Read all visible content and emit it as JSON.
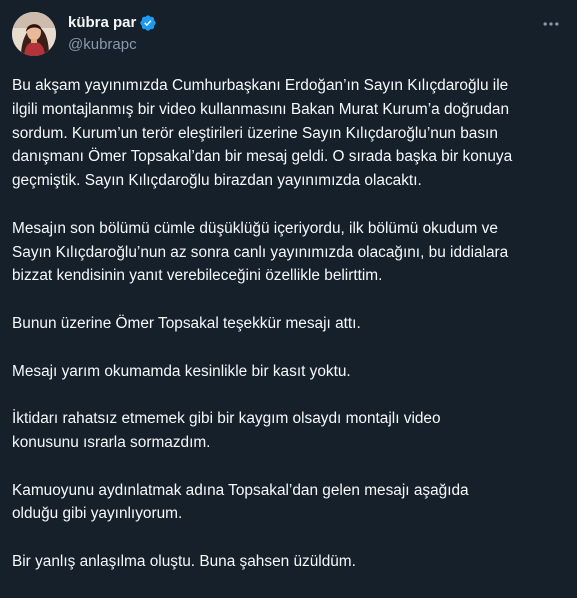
{
  "author": {
    "display_name": "kübra par",
    "handle": "@kubrapc",
    "verified": true,
    "avatar_icon": "user-avatar-photo",
    "verified_icon": "verified-badge-icon",
    "verified_color": "#1d9bf0"
  },
  "actions": {
    "more_icon": "more-horizontal-icon"
  },
  "tweet": {
    "paragraphs": [
      {
        "lines": [
          "Bu akşam yayınımızda Cumhurbaşkanı Erdoğan’ın Sayın Kılıçdaroğlu ile",
          "ilgili montajlanmış bir video kullanmasını Bakan Murat Kurum’a doğrudan",
          "sordum. Kurum’un terör eleştirileri üzerine Sayın Kılıçdaroğlu’nun basın",
          "danışmanı Ömer Topsakal’dan bir mesaj geldi. O sırada başka bir konuya",
          "geçmiştik. Sayın Kılıçdaroğlu birazdan yayınımızda olacaktı."
        ]
      },
      {
        "lines": [
          "Mesajın son bölümü cümle düşüklüğü içeriyordu, ilk bölümü okudum ve",
          "Sayın Kılıçdaroğlu’nun az sonra canlı yayınımızda olacağını, bu iddialara",
          "bizzat kendisinin yanıt verebileceğini özellikle belirttim."
        ]
      },
      {
        "lines": [
          "Bunun üzerine Ömer Topsakal teşekkür mesajı attı."
        ]
      },
      {
        "lines": [
          "Mesajı yarım okumamda kesinlikle bir kasıt yoktu."
        ]
      },
      {
        "lines": [
          "İktidarı rahatsız etmemek gibi bir kaygım olsaydı montajlı video",
          "konusunu ısrarla sormazdım."
        ]
      },
      {
        "lines": [
          "Kamuoyunu aydınlatmak adına Topsakal’dan gelen mesajı aşağıda",
          "olduğu gibi yayınlıyorum."
        ]
      },
      {
        "lines": [
          "Bir yanlış anlaşılma oluştu. Buna şahsen üzüldüm."
        ]
      }
    ]
  },
  "colors": {
    "background": "#15202b",
    "text_primary": "#f7f9f9",
    "text_secondary": "#8b98a5"
  }
}
